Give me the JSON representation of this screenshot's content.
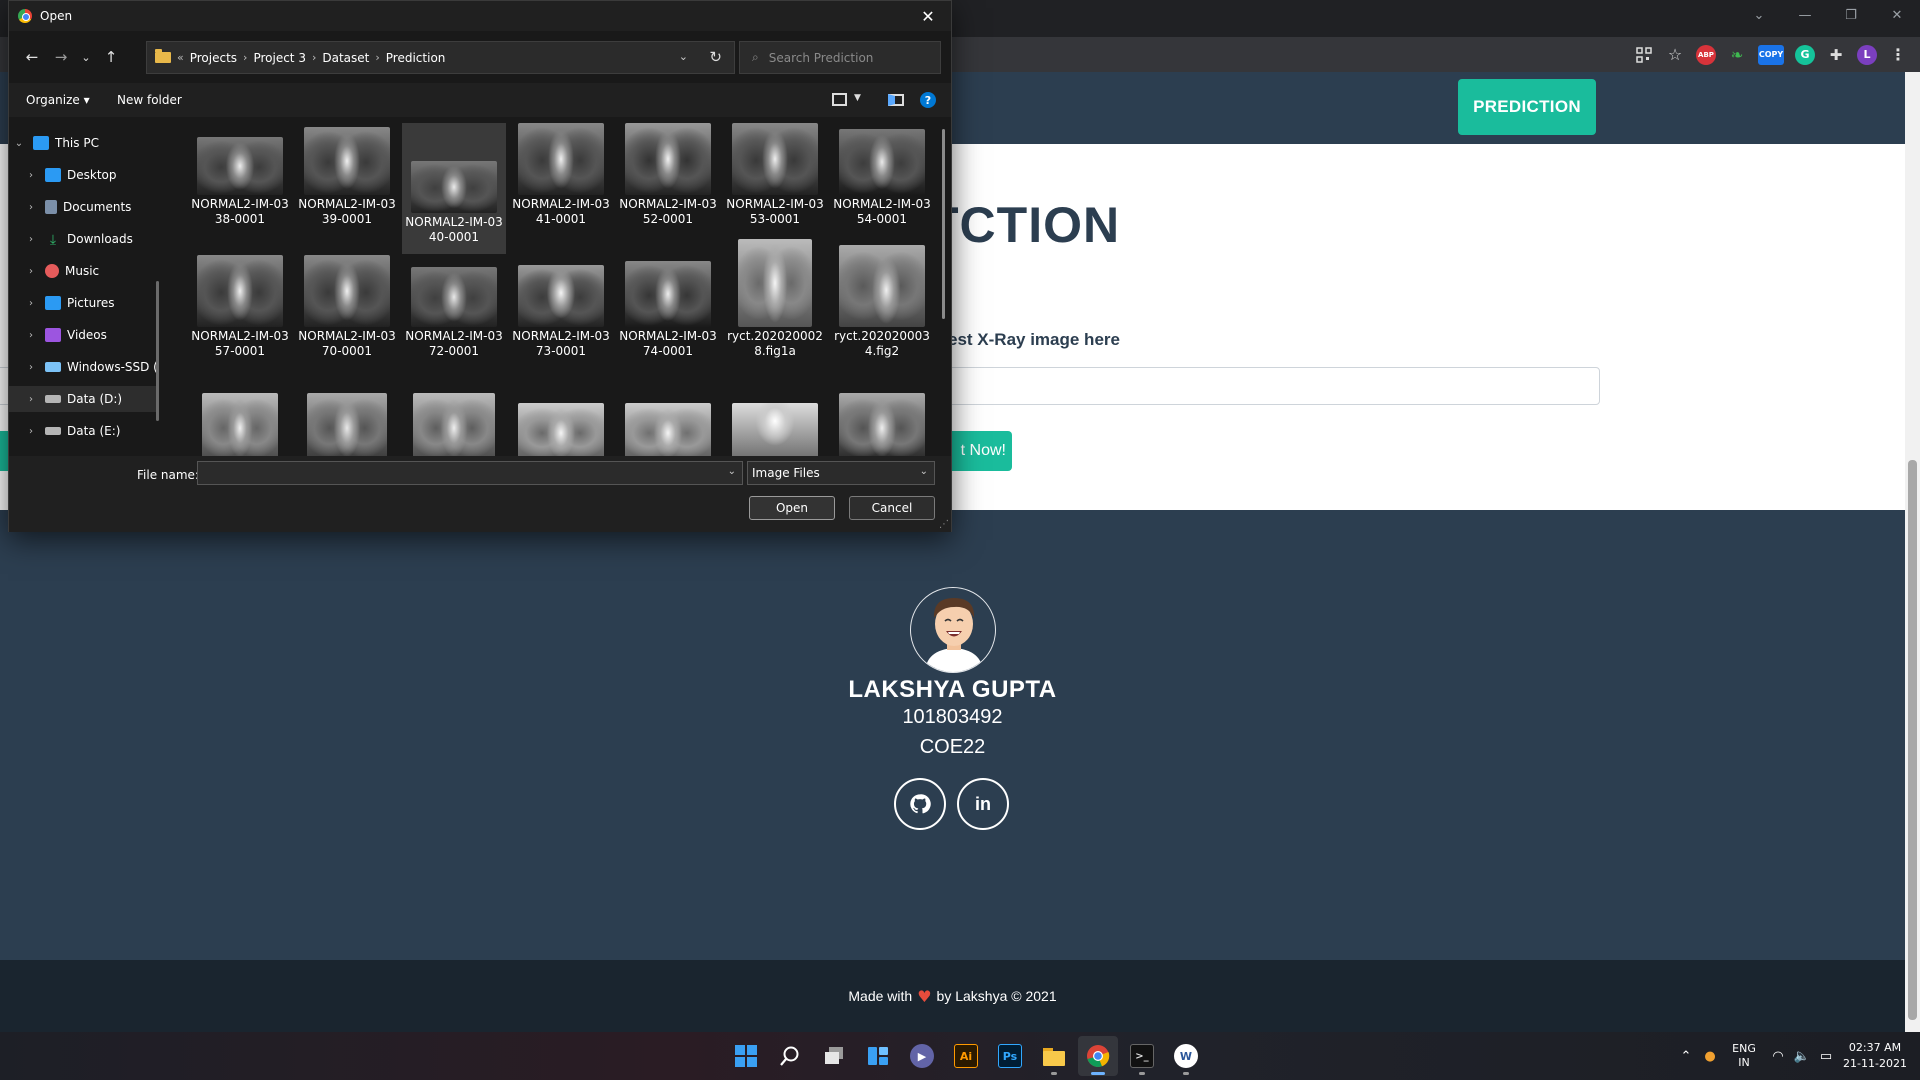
{
  "browser": {
    "window_controls": {
      "dropdown": "⌄",
      "minimize": "—",
      "restore": "❐",
      "close": "✕"
    },
    "extensions": [
      "qr-code-icon",
      "star-icon",
      "adblock-icon",
      "leaf-icon",
      "copy-extension-icon",
      "grammarly-icon",
      "puzzle-icon",
      "profile-avatar",
      "more-icon"
    ],
    "extension_labels": {
      "adblock": "ABP",
      "copy": "COPY",
      "grammarly": "G",
      "profile": "L"
    }
  },
  "page": {
    "nav_button": "PREDICTION",
    "title_visible": "TCTION",
    "upload_label_visible": "est X-Ray image here",
    "submit_visible": "t Now!",
    "profile": {
      "name": "LAKSHYA GUPTA",
      "roll": "101803492",
      "group": "COE22"
    },
    "social": {
      "github": "⌥",
      "linkedin": "in"
    },
    "footer": {
      "made_with": "Made with",
      "heart": "♥",
      "by": "by Lakshya © 2021"
    }
  },
  "dialog": {
    "title": "Open",
    "breadcrumb": {
      "overflow": "«",
      "items": [
        "Projects",
        "Project 3",
        "Dataset",
        "Prediction"
      ]
    },
    "search_placeholder": "Search Prediction",
    "toolbar": {
      "organize": "Organize ▾",
      "new_folder": "New folder",
      "help": "?"
    },
    "nav_pane": [
      {
        "label": "This PC",
        "color": "#2b9af3"
      },
      {
        "label": "Desktop",
        "color": "#2b9af3"
      },
      {
        "label": "Documents",
        "color": "#7b8fa8"
      },
      {
        "label": "Downloads",
        "color": "#2fb56a"
      },
      {
        "label": "Music",
        "color": "#e55b5b"
      },
      {
        "label": "Pictures",
        "color": "#2b9af3"
      },
      {
        "label": "Videos",
        "color": "#9c55e0"
      },
      {
        "label": "Windows-SSD (",
        "color": "#7cc2f6"
      },
      {
        "label": "Data (D:)",
        "color": "#b5b5b5"
      },
      {
        "label": "Data (E:)",
        "color": "#b5b5b5"
      }
    ],
    "files": [
      "NORMAL2-IM-0338-0001",
      "NORMAL2-IM-0339-0001",
      "NORMAL2-IM-0340-0001",
      "NORMAL2-IM-0341-0001",
      "NORMAL2-IM-0352-0001",
      "NORMAL2-IM-0353-0001",
      "NORMAL2-IM-0354-0001",
      "NORMAL2-IM-0357-0001",
      "NORMAL2-IM-0370-0001",
      "NORMAL2-IM-0372-0001",
      "NORMAL2-IM-0373-0001",
      "NORMAL2-IM-0374-0001",
      "ryct.2020200028.fig1a",
      "ryct.2020200034.fig2"
    ],
    "selected_file": "NORMAL2-IM-0340-0001",
    "file_name_label": "File name:",
    "file_name_value": "",
    "file_type": "Image Files",
    "open_button": "Open",
    "cancel_button": "Cancel"
  },
  "taskbar": {
    "apps": [
      "windows-start-icon",
      "search-icon",
      "task-view-icon",
      "widgets-icon",
      "teams-chat-icon",
      "illustrator-icon",
      "photoshop-icon",
      "file-explorer-icon",
      "chrome-icon",
      "terminal-icon",
      "word-icon"
    ],
    "app_labels": {
      "illustrator": "Ai",
      "photoshop": "Ps"
    },
    "tray": {
      "lang_line1": "ENG",
      "lang_line2": "IN",
      "time": "02:37 AM",
      "date": "21-11-2021"
    }
  }
}
